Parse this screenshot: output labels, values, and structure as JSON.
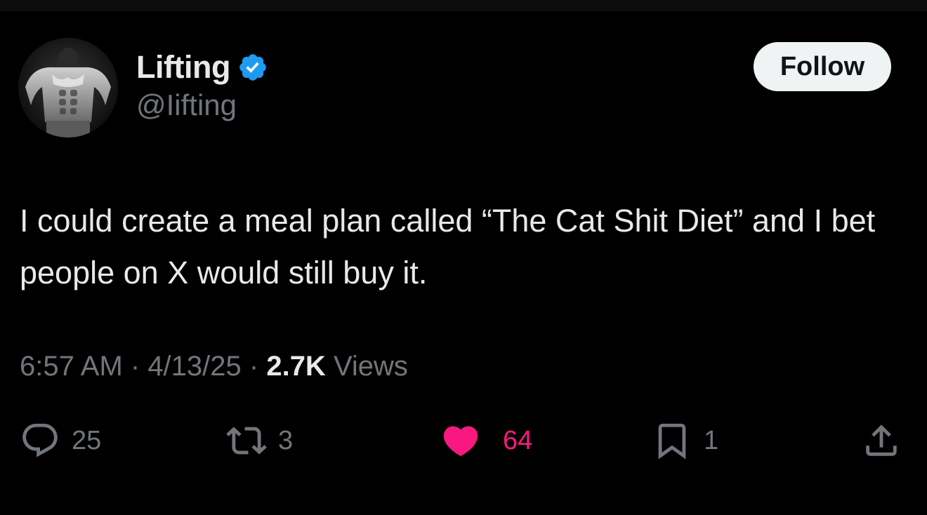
{
  "author": {
    "display_name": "Lifting",
    "handle": "@Iifting",
    "verified": true
  },
  "follow_label": "Follow",
  "tweet": {
    "text": "I could create a meal plan called “The Cat Shit Diet” and I bet people on X would still buy it."
  },
  "meta": {
    "time": "6:57 AM",
    "separator_1": " · ",
    "date": "4/13/25",
    "separator_2": " · ",
    "views_count": "2.7K",
    "views_label": " Views"
  },
  "actions": {
    "replies": "25",
    "reposts": "3",
    "likes": "64",
    "bookmarks": "1"
  },
  "colors": {
    "background": "#000000",
    "text_primary": "#e7e9ea",
    "text_secondary": "#71767b",
    "verified_blue": "#1d9bf0",
    "like_pink": "#f91880",
    "follow_bg": "#eff3f4"
  },
  "icons": {
    "verified": "verified-badge-icon",
    "reply": "reply-icon",
    "repost": "repost-icon",
    "like": "heart-icon",
    "bookmark": "bookmark-icon",
    "share": "share-icon"
  }
}
